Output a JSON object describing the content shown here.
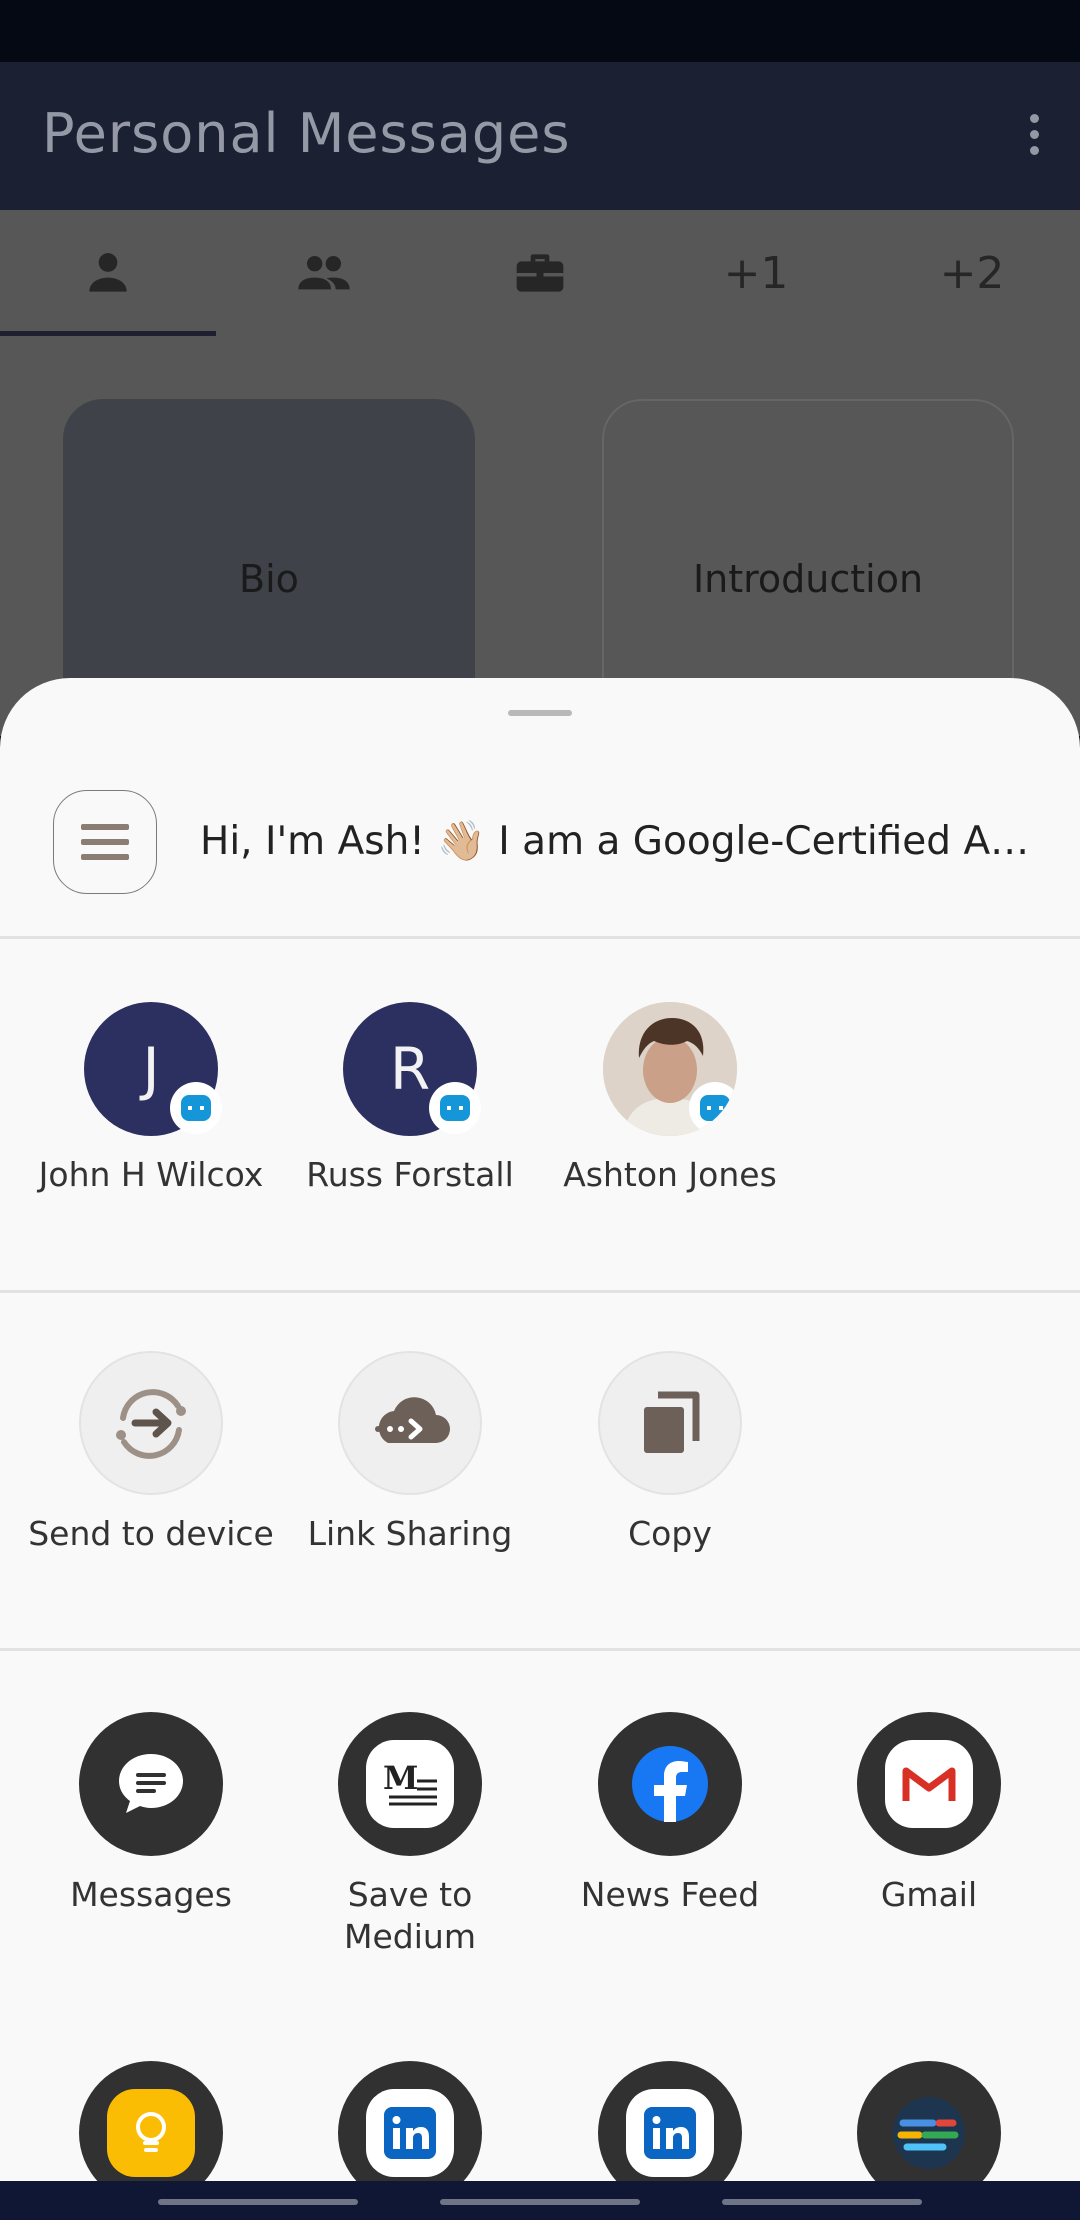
{
  "app": {
    "title": "Personal Messages",
    "tabs": [
      {
        "type": "icon",
        "icon": "person-icon"
      },
      {
        "type": "icon",
        "icon": "group-icon"
      },
      {
        "type": "icon",
        "icon": "briefcase-icon"
      },
      {
        "type": "text",
        "label": "+1"
      },
      {
        "type": "text",
        "label": "+2"
      }
    ],
    "cards": [
      "Bio",
      "Introduction"
    ]
  },
  "share_sheet": {
    "preview_text": "Hi, I'm Ash! 👋🏼 I am a Google-Certified Andr...",
    "contacts": [
      {
        "name": "John H Wilcox",
        "initial": "J"
      },
      {
        "name": "Russ Forstall",
        "initial": "R"
      },
      {
        "name": "Ashton Jones",
        "initial": ""
      }
    ],
    "actions": [
      {
        "label": "Send to device",
        "icon": "send-to-device-icon"
      },
      {
        "label": "Link Sharing",
        "icon": "cloud-link-icon"
      },
      {
        "label": "Copy",
        "icon": "copy-icon"
      }
    ],
    "apps": [
      {
        "label": "Messages",
        "icon": "messages-icon"
      },
      {
        "label": "Save to Medium",
        "icon": "medium-icon"
      },
      {
        "label": "News Feed",
        "icon": "facebook-icon"
      },
      {
        "label": "Gmail",
        "icon": "gmail-icon"
      }
    ],
    "apps_row2": [
      {
        "icon": "keep-lightbulb-icon"
      },
      {
        "icon": "linkedin-icon"
      },
      {
        "icon": "linkedin-icon"
      },
      {
        "icon": "colored-lines-icon"
      }
    ]
  },
  "colors": {
    "appbar": "#1c2033",
    "scrim": "#575757",
    "sheet": "#f9f9f9",
    "badge": "#1596d8"
  }
}
